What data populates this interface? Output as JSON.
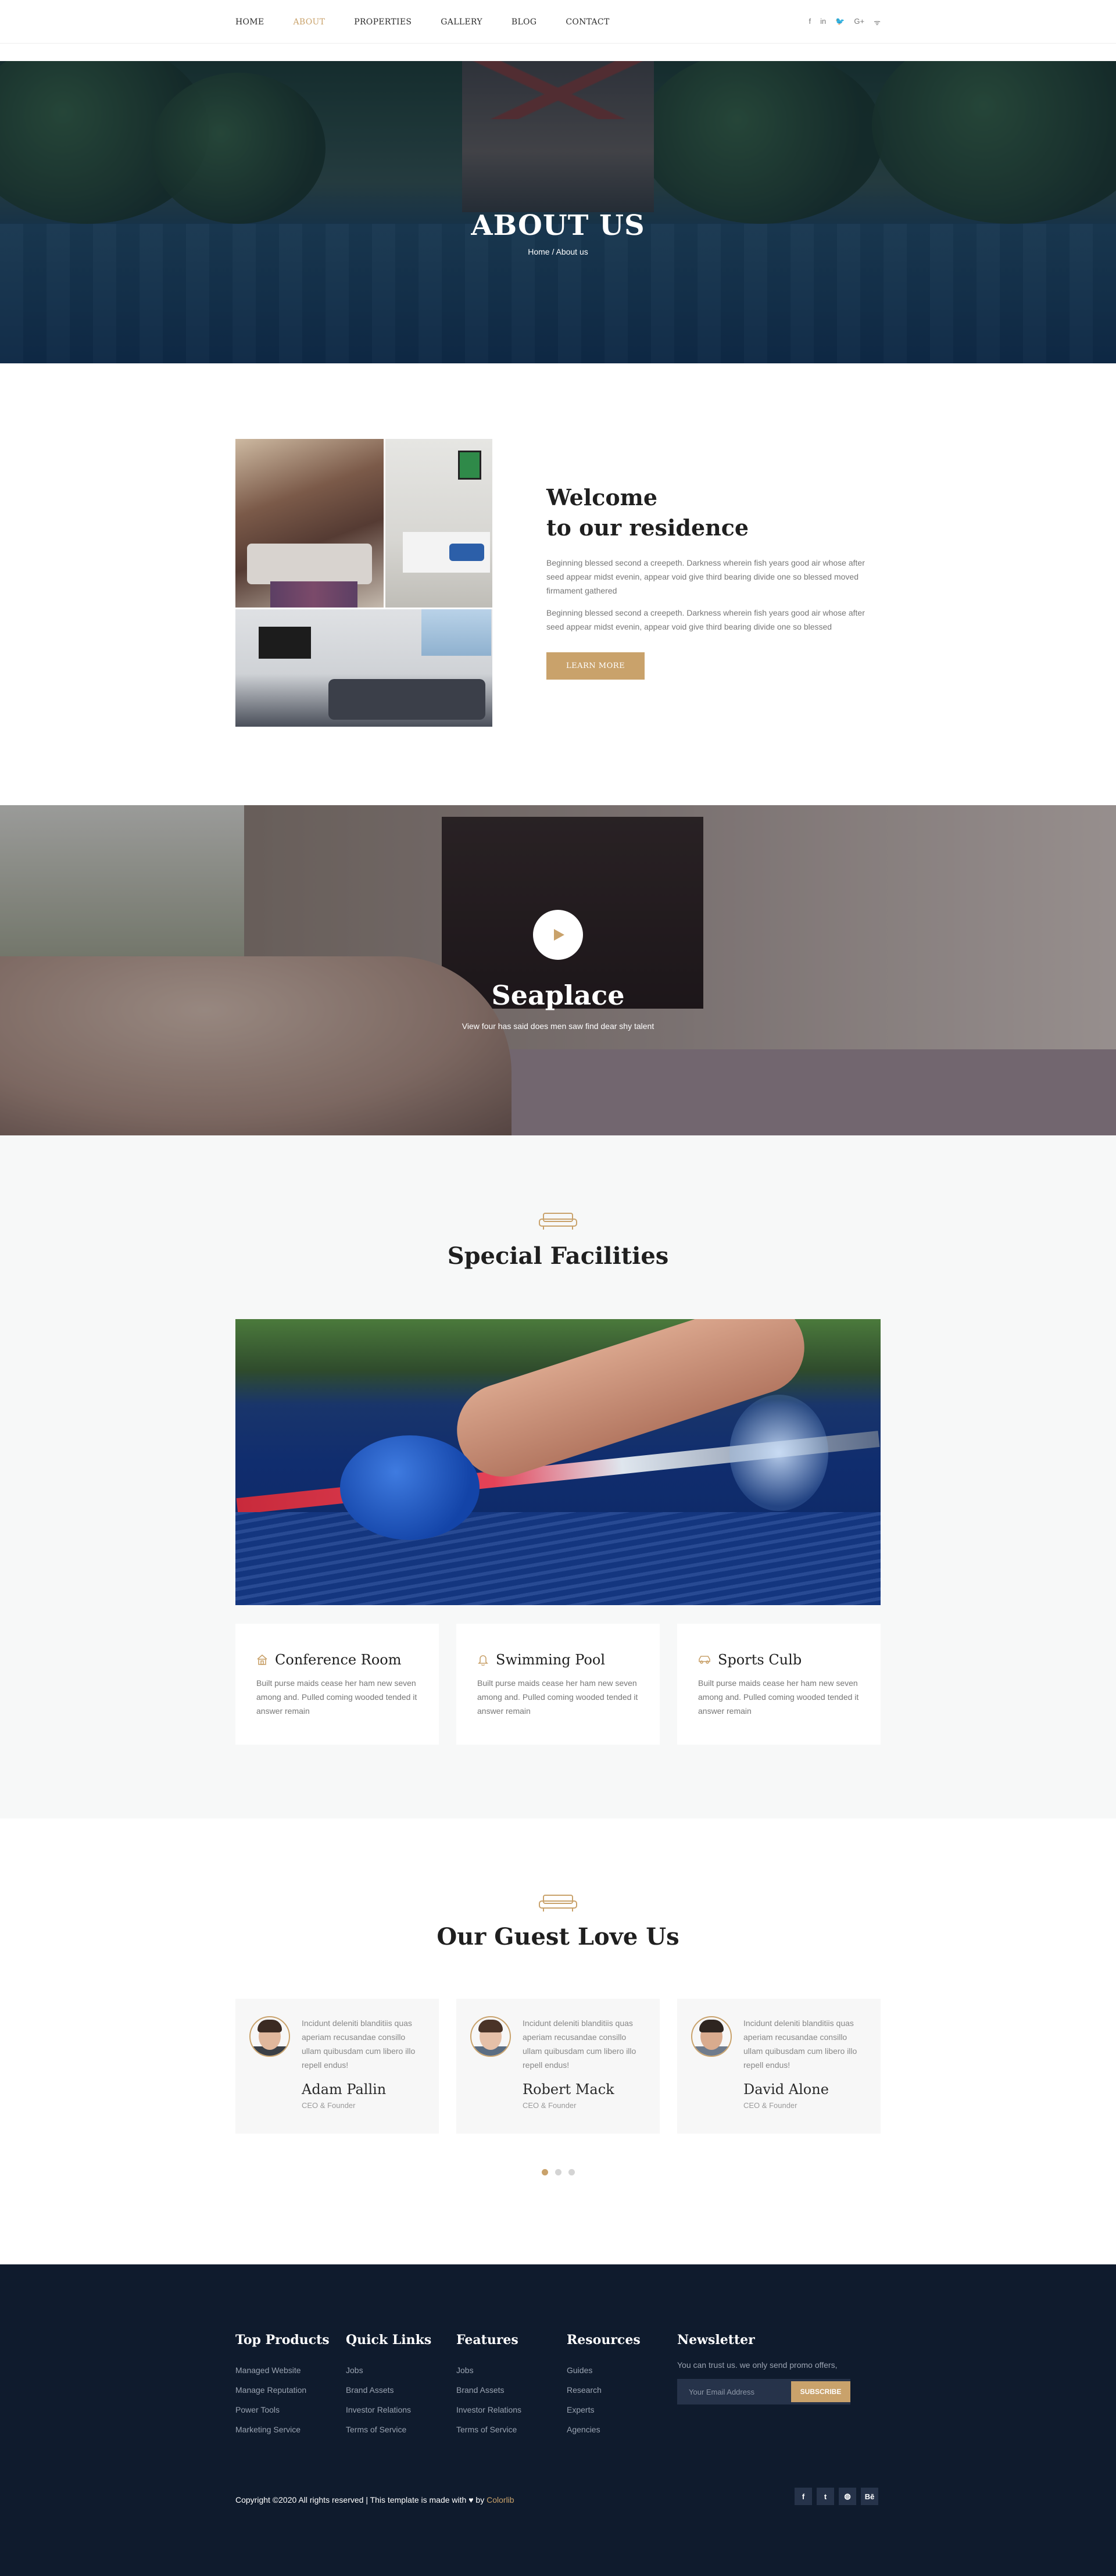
{
  "nav": {
    "items": [
      {
        "label": "HOME",
        "active": false
      },
      {
        "label": "ABOUT",
        "active": true
      },
      {
        "label": "PROPERTIES",
        "active": false
      },
      {
        "label": "GALLERY",
        "active": false
      },
      {
        "label": "BLOG",
        "active": false
      },
      {
        "label": "CONTACT",
        "active": false
      }
    ],
    "social": [
      {
        "icon": "facebook-icon",
        "glyph": "f"
      },
      {
        "icon": "linkedin-icon",
        "glyph": "in"
      },
      {
        "icon": "twitter-icon",
        "glyph": "🐦"
      },
      {
        "icon": "google-plus-icon",
        "glyph": "G+"
      },
      {
        "icon": "rss-icon",
        "glyph": "ᯤ"
      }
    ]
  },
  "hero": {
    "title": "ABOUT US",
    "breadcrumb": "Home / About us"
  },
  "welcome": {
    "title_line1": "Welcome",
    "title_line2": "to our residence",
    "para1": "Beginning blessed second a creepeth. Darkness wherein fish years good air whose after seed appear midst evenin, appear void give third bearing divide one so blessed moved firmament gathered",
    "para2": "Beginning blessed second a creepeth. Darkness wherein fish years good air whose after seed appear midst evenin, appear void give third bearing divide one so blessed",
    "button": "LEARN MORE"
  },
  "video": {
    "title": "Seaplace",
    "subtitle": "View four has said does men saw find dear shy talent"
  },
  "facilities": {
    "title": "Special Facilities",
    "cards": [
      {
        "icon": "hotel-icon",
        "title": "Conference Room",
        "text": "Built purse maids cease her ham new seven among and. Pulled coming wooded tended it answer remain"
      },
      {
        "icon": "bell-icon",
        "title": "Swimming Pool",
        "text": "Built purse maids cease her ham new seven among and. Pulled coming wooded tended it answer remain"
      },
      {
        "icon": "car-icon",
        "title": "Sports Culb",
        "text": "Built purse maids cease her ham new seven among and. Pulled coming wooded tended it answer remain"
      }
    ]
  },
  "guests": {
    "title": "Our Guest Love Us",
    "items": [
      {
        "quote": "Incidunt deleniti blanditiis quas aperiam recusandae consillo ullam quibusdam cum libero illo repell endus!",
        "name": "Adam Pallin",
        "role": "CEO & Founder"
      },
      {
        "quote": "Incidunt deleniti blanditiis quas aperiam recusandae consillo ullam quibusdam cum libero illo repell endus!",
        "name": "Robert Mack",
        "role": "CEO & Founder"
      },
      {
        "quote": "Incidunt deleniti blanditiis quas aperiam recusandae consillo ullam quibusdam cum libero illo repell endus!",
        "name": "David Alone",
        "role": "CEO & Founder"
      }
    ],
    "active_dot": 0
  },
  "footer": {
    "columns": [
      {
        "title": "Top Products",
        "links": [
          "Managed Website",
          "Manage Reputation",
          "Power Tools",
          "Marketing Service"
        ]
      },
      {
        "title": "Quick Links",
        "links": [
          "Jobs",
          "Brand Assets",
          "Investor Relations",
          "Terms of Service"
        ]
      },
      {
        "title": "Features",
        "links": [
          "Jobs",
          "Brand Assets",
          "Investor Relations",
          "Terms of Service"
        ]
      },
      {
        "title": "Resources",
        "links": [
          "Guides",
          "Research",
          "Experts",
          "Agencies"
        ]
      }
    ],
    "newsletter": {
      "title": "Newsletter",
      "text": "You can trust us. we only send promo offers,",
      "placeholder": "Your Email Address",
      "button": "SUBSCRIBE"
    },
    "copyright": "Copyright ©2020 All rights reserved | This template is made with",
    "by": "by",
    "brand": "Colorlib",
    "social": [
      {
        "icon": "facebook-icon",
        "glyph": "f"
      },
      {
        "icon": "twitter-icon",
        "glyph": "t"
      },
      {
        "icon": "dribbble-icon",
        "glyph": "◍"
      },
      {
        "icon": "behance-icon",
        "glyph": "Bē"
      }
    ]
  },
  "colors": {
    "accent": "#c9a26b",
    "footer_bg": "#0f1b2d",
    "section_bg": "#f7f8f8"
  }
}
